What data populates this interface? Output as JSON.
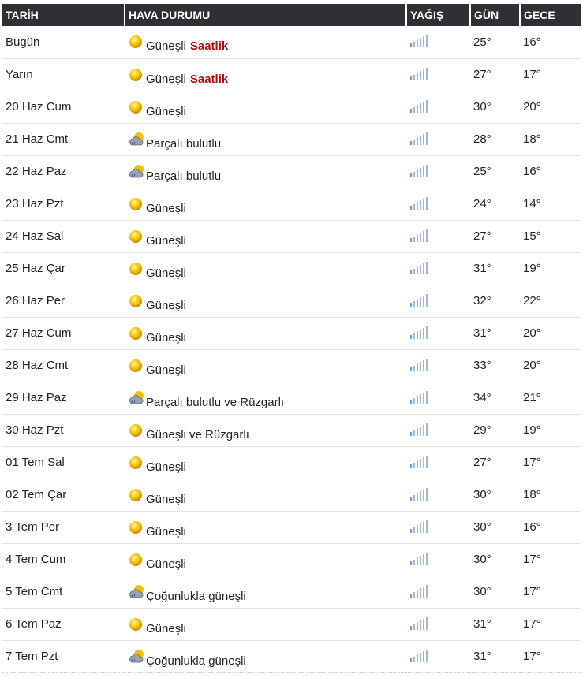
{
  "headers": {
    "date": "TARİH",
    "condition": "HAVA DURUMU",
    "precip": "YAĞIŞ",
    "day": "GÜN",
    "night": "GECE"
  },
  "colors": {
    "header_bg": "#2f3033",
    "link_red": "#b50d14",
    "sun": "#f2c200",
    "rain_bar": "#6f9bc9"
  },
  "rows": [
    {
      "date": "Bugün",
      "icon": "sun-icon",
      "condition": "Güneşli",
      "link": "Saatlik",
      "precip_icon": "rain-bars-icon",
      "day": "25°",
      "night": "16°"
    },
    {
      "date": "Yarın",
      "icon": "sun-icon",
      "condition": "Güneşli",
      "link": "Saatlik",
      "precip_icon": "rain-bars-icon",
      "day": "27°",
      "night": "17°"
    },
    {
      "date": "20 Haz Cum",
      "icon": "sun-icon",
      "condition": "Güneşli",
      "precip_icon": "rain-bars-icon",
      "day": "30°",
      "night": "20°"
    },
    {
      "date": "21 Haz Cmt",
      "icon": "partly-cloudy-icon",
      "condition": "Parçalı bulutlu",
      "precip_icon": "rain-bars-icon",
      "day": "28°",
      "night": "18°"
    },
    {
      "date": "22 Haz Paz",
      "icon": "partly-cloudy-icon",
      "condition": "Parçalı bulutlu",
      "precip_icon": "rain-bars-icon",
      "day": "25°",
      "night": "16°"
    },
    {
      "date": "23 Haz Pzt",
      "icon": "sun-icon",
      "condition": "Güneşli",
      "precip_icon": "rain-bars-icon",
      "day": "24°",
      "night": "14°"
    },
    {
      "date": "24 Haz Sal",
      "icon": "sun-icon",
      "condition": "Güneşli",
      "precip_icon": "rain-bars-icon",
      "day": "27°",
      "night": "15°"
    },
    {
      "date": "25 Haz Çar",
      "icon": "sun-icon",
      "condition": "Güneşli",
      "precip_icon": "rain-bars-icon",
      "day": "31°",
      "night": "19°"
    },
    {
      "date": "26 Haz Per",
      "icon": "sun-icon",
      "condition": "Güneşli",
      "precip_icon": "rain-bars-icon",
      "day": "32°",
      "night": "22°"
    },
    {
      "date": "27 Haz Cum",
      "icon": "sun-icon",
      "condition": "Güneşli",
      "precip_icon": "rain-bars-icon",
      "day": "31°",
      "night": "20°"
    },
    {
      "date": "28 Haz Cmt",
      "icon": "sun-icon",
      "condition": "Güneşli",
      "precip_icon": "rain-bars-icon",
      "day": "33°",
      "night": "20°"
    },
    {
      "date": "29 Haz Paz",
      "icon": "partly-cloudy-icon",
      "condition": "Parçalı bulutlu ve Rüzgarlı",
      "precip_icon": "rain-bars-icon",
      "day": "34°",
      "night": "21°"
    },
    {
      "date": "30 Haz Pzt",
      "icon": "sun-icon",
      "condition": "Güneşli ve Rüzgarlı",
      "precip_icon": "rain-bars-icon",
      "day": "29°",
      "night": "19°"
    },
    {
      "date": "01 Tem Sal",
      "icon": "sun-icon",
      "condition": "Güneşli",
      "precip_icon": "rain-bars-icon",
      "day": "27°",
      "night": "17°"
    },
    {
      "date": "02 Tem Çar",
      "icon": "sun-icon",
      "condition": "Güneşli",
      "precip_icon": "rain-bars-icon",
      "day": "30°",
      "night": "18°"
    },
    {
      "date": "3 Tem Per",
      "icon": "sun-icon",
      "condition": "Güneşli",
      "precip_icon": "rain-bars-icon",
      "day": "30°",
      "night": "16°"
    },
    {
      "date": "4 Tem Cum",
      "icon": "sun-icon",
      "condition": "Güneşli",
      "precip_icon": "rain-bars-icon",
      "day": "30°",
      "night": "17°"
    },
    {
      "date": "5 Tem Cmt",
      "icon": "partly-cloudy-icon",
      "condition": "Çoğunlukla güneşli",
      "precip_icon": "rain-bars-icon",
      "day": "30°",
      "night": "17°"
    },
    {
      "date": "6 Tem Paz",
      "icon": "sun-icon",
      "condition": "Güneşli",
      "precip_icon": "rain-bars-icon",
      "day": "31°",
      "night": "17°"
    },
    {
      "date": "7 Tem Pzt",
      "icon": "partly-cloudy-icon",
      "condition": "Çoğunlukla güneşli",
      "precip_icon": "rain-bars-icon",
      "day": "31°",
      "night": "17°"
    }
  ]
}
